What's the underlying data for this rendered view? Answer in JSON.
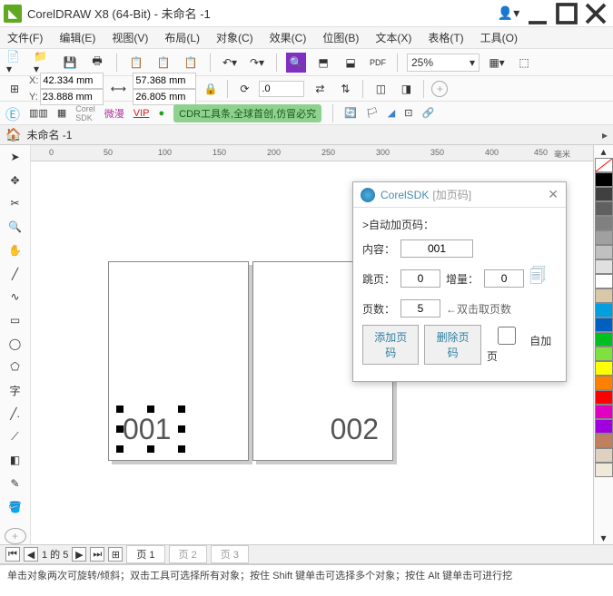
{
  "window": {
    "title": "CorelDRAW X8 (64-Bit) - 未命名 -1"
  },
  "menu": {
    "file": "文件(F)",
    "edit": "编辑(E)",
    "view": "视图(V)",
    "layout": "布局(L)",
    "object": "对象(C)",
    "effect": "效果(C)",
    "bitmap": "位图(B)",
    "text": "文本(X)",
    "table": "表格(T)",
    "tools": "工具(O)"
  },
  "toolbar": {
    "zoom": "25%"
  },
  "props": {
    "xlabel": "X:",
    "ylabel": "Y:",
    "x": "42.334 mm",
    "y": "23.888 mm",
    "w": "57.368 mm",
    "h": "26.805 mm",
    "rot": ".0"
  },
  "plugin": {
    "wm": "微漫",
    "vip": "VIP",
    "badge": "CDR工具条,全球首创,仿冒必究",
    "sdk": "SDK",
    "corel": "Corel"
  },
  "doc": {
    "name": "未命名 -1"
  },
  "hruler": {
    "t0": "0",
    "t1": "50",
    "t2": "100",
    "t3": "150",
    "t4": "200",
    "t5": "250",
    "t6": "300",
    "t7": "350",
    "t8": "400",
    "t9": "450",
    "unit": "毫米"
  },
  "canvas": {
    "p1": "001",
    "p2": "002"
  },
  "palette": [
    "#000000",
    "#404040",
    "#606060",
    "#808080",
    "#a0a0a0",
    "#c0c0c0",
    "#e0e0e0",
    "#ffffff",
    "#d8c8a8",
    "#00a0e0",
    "#0060c0",
    "#00c020",
    "#80e040",
    "#ffff00",
    "#ff8000",
    "#ff0000",
    "#e000c0",
    "#a000e0",
    "#c08060",
    "#e0d0c0",
    "#f0e8d8"
  ],
  "dialog": {
    "brand": "CorelSDK",
    "sub": "[加页码]",
    "auto": ">自动加页码：",
    "content_lbl": "内容：",
    "content_val": "001",
    "skip_lbl": "跳页：",
    "skip_val": "0",
    "inc_lbl": "增量：",
    "inc_val": "0",
    "count_lbl": "页数：",
    "count_val": "5",
    "count_hint": "←双击取页数",
    "btn_add": "添加页码",
    "btn_del": "删除页码",
    "cb_self": "自加页"
  },
  "pagebar": {
    "pos": "1 的 5",
    "p1": "页 1",
    "p2": "页 2",
    "p3": "页 3"
  },
  "status": {
    "text": "单击对象两次可旋转/倾斜；双击工具可选择所有对象；按住 Shift 键单击可选择多个对象；按住 Alt 键单击可进行挖"
  }
}
